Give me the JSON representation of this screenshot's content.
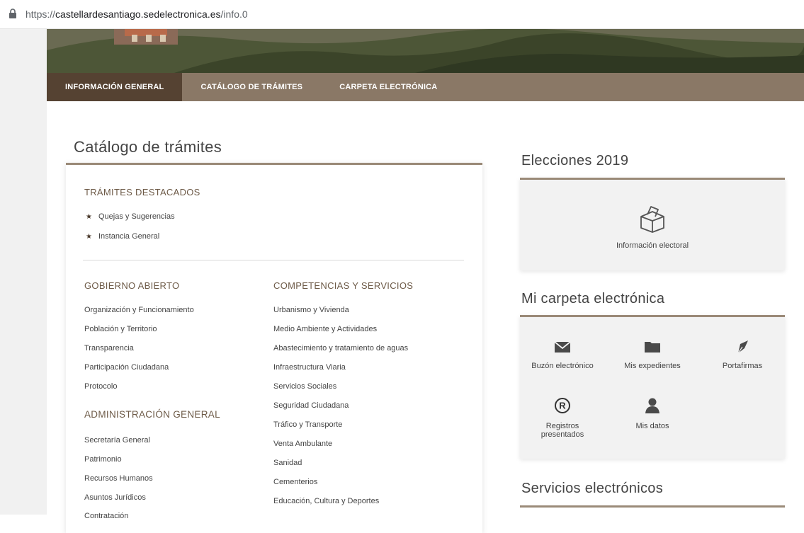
{
  "browser": {
    "url_scheme": "https://",
    "url_host": "castellardesantiago.sedelectronica.es",
    "url_path": "/info.0"
  },
  "nav": {
    "items": [
      {
        "label": "INFORMACIÓN GENERAL",
        "active": true
      },
      {
        "label": "CATÁLOGO DE TRÁMITES",
        "active": false
      },
      {
        "label": "CARPETA ELECTRÓNICA",
        "active": false
      }
    ]
  },
  "catalog": {
    "title": "Catálogo de trámites",
    "featured": {
      "heading": "TRÁMITES DESTACADOS",
      "items": [
        "Quejas y Sugerencias",
        "Instancia General"
      ]
    },
    "gobierno": {
      "heading": "GOBIERNO ABIERTO",
      "items": [
        "Organización y Funcionamiento",
        "Población y Territorio",
        "Transparencia",
        "Participación Ciudadana",
        "Protocolo"
      ]
    },
    "administracion": {
      "heading": "ADMINISTRACIÓN GENERAL",
      "items": [
        "Secretaría General",
        "Patrimonio",
        "Recursos Humanos",
        "Asuntos Jurídicos",
        "Contratación"
      ]
    },
    "competencias": {
      "heading": "COMPETENCIAS Y SERVICIOS",
      "items": [
        "Urbanismo y Vivienda",
        "Medio Ambiente y Actividades",
        "Abastecimiento y tratamiento de aguas",
        "Infraestructura Viaria",
        "Servicios Sociales",
        "Seguridad Ciudadana",
        "Tráfico y Transporte",
        "Venta Ambulante",
        "Sanidad",
        "Cementerios",
        "Educación, Cultura y Deportes"
      ]
    }
  },
  "elecciones": {
    "title": "Elecciones 2019",
    "tile_label": "Información electoral",
    "icon": "ballot-box-icon"
  },
  "carpeta": {
    "title": "Mi carpeta electrónica",
    "tiles": [
      {
        "label": "Buzón electrónico",
        "icon": "envelope-icon"
      },
      {
        "label": "Mis expedientes",
        "icon": "folder-icon"
      },
      {
        "label": "Portafirmas",
        "icon": "pen-nib-icon"
      },
      {
        "label": "Registros presentados",
        "icon": "registered-icon"
      },
      {
        "label": "Mis datos",
        "icon": "user-icon"
      }
    ]
  },
  "servicios": {
    "title": "Servicios electrónicos"
  },
  "colors": {
    "nav_bg": "#8a7866",
    "nav_active": "#554232",
    "accent_border": "#9a8a78",
    "section_heading": "#6d5a47",
    "card_bg": "#f2f2f2"
  }
}
